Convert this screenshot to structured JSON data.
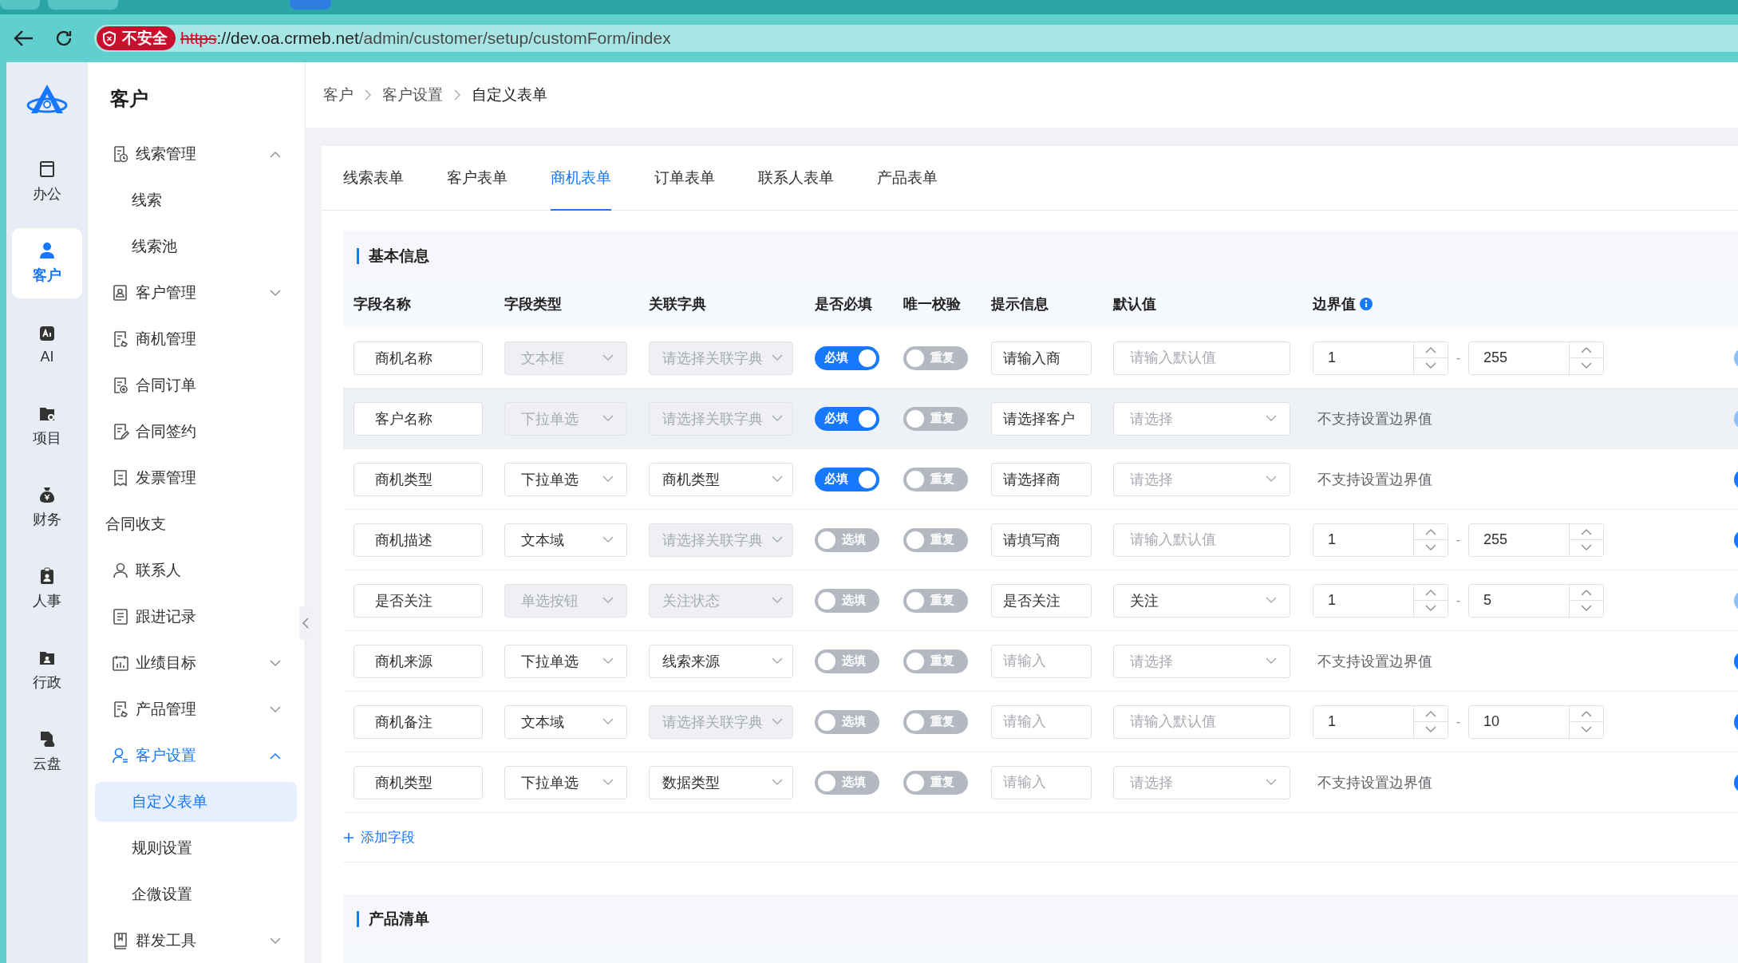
{
  "browser": {
    "tabs": [
      {
        "selected": false
      },
      {
        "selected": false
      },
      {
        "selected": true
      }
    ],
    "security_badge": "不安全",
    "url_scheme": "https",
    "url_host": "://dev.oa.crmeb.net",
    "url_path": "/admin/customer/setup/customForm/index"
  },
  "rail": {
    "items": [
      {
        "label": "办公",
        "selected": false
      },
      {
        "label": "客户",
        "selected": true
      },
      {
        "label": "AI",
        "selected": false
      },
      {
        "label": "项目",
        "selected": false
      },
      {
        "label": "财务",
        "selected": false
      },
      {
        "label": "人事",
        "selected": false
      },
      {
        "label": "行政",
        "selected": false
      },
      {
        "label": "云盘",
        "selected": false
      }
    ]
  },
  "menu": {
    "title": "客户",
    "items": [
      {
        "label": "线索管理",
        "selected": false,
        "expanded": true,
        "children": [
          {
            "label": "线索",
            "selected": false
          },
          {
            "label": "线索池",
            "selected": false
          }
        ]
      },
      {
        "label": "客户管理",
        "selected": false,
        "expanded": false
      },
      {
        "label": "商机管理",
        "selected": false
      },
      {
        "label": "合同订单",
        "selected": false
      },
      {
        "label": "合同签约",
        "selected": false
      },
      {
        "label": "发票管理",
        "selected": false
      },
      {
        "label": "合同收支",
        "selected": false
      },
      {
        "label": "联系人",
        "selected": false
      },
      {
        "label": "跟进记录",
        "selected": false
      },
      {
        "label": "业绩目标",
        "selected": false,
        "expanded": false
      },
      {
        "label": "产品管理",
        "selected": false,
        "expanded": false
      },
      {
        "label": "客户设置",
        "selected": true,
        "expanded": true,
        "children": [
          {
            "label": "自定义表单",
            "selected": true
          },
          {
            "label": "规则设置",
            "selected": false
          },
          {
            "label": "企微设置",
            "selected": false
          }
        ]
      },
      {
        "label": "群发工具",
        "selected": false,
        "expanded": false
      }
    ]
  },
  "breadcrumb": [
    "客户",
    "客户设置",
    "自定义表单"
  ],
  "tabs": [
    {
      "label": "线索表单",
      "selected": false
    },
    {
      "label": "客户表单",
      "selected": false
    },
    {
      "label": "商机表单",
      "selected": true
    },
    {
      "label": "订单表单",
      "selected": false
    },
    {
      "label": "联系人表单",
      "selected": false
    },
    {
      "label": "产品表单",
      "selected": false
    }
  ],
  "sections": [
    {
      "title": "基本信息",
      "columns": [
        "字段名称",
        "字段类型",
        "关联字典",
        "是否必填",
        "唯一校验",
        "提示信息",
        "默认值",
        "边界值"
      ],
      "rows": [
        {
          "highlighted": false,
          "name": "商机名称",
          "type": {
            "value": "文本框",
            "disabled": true
          },
          "dict": {
            "placeholder": "请选择关联字典",
            "disabled": true
          },
          "required": {
            "on": true,
            "label": "必填"
          },
          "unique": {
            "on": false,
            "label": "重复"
          },
          "hint": {
            "value": "请输入商"
          },
          "default": {
            "kind": "input",
            "placeholder": "请输入默认值"
          },
          "bounds": {
            "kind": "range",
            "min": "1",
            "separator": "-",
            "max": "255"
          },
          "column_9": {
            "dimmed": true
          }
        },
        {
          "highlighted": true,
          "name": "客户名称",
          "type": {
            "value": "下拉单选",
            "disabled": true
          },
          "dict": {
            "placeholder": "请选择关联字典",
            "disabled": true
          },
          "required": {
            "on": true,
            "label": "必填"
          },
          "unique": {
            "on": false,
            "label": "重复"
          },
          "hint": {
            "value": "请选择客户"
          },
          "default": {
            "kind": "select",
            "placeholder": "请选择"
          },
          "bounds": {
            "kind": "text",
            "text": "不支持设置边界值"
          },
          "column_9": {
            "dimmed": true
          }
        },
        {
          "highlighted": false,
          "name": "商机类型",
          "type": {
            "value": "下拉单选",
            "disabled": false
          },
          "dict": {
            "value": "商机类型",
            "disabled": false
          },
          "required": {
            "on": true,
            "label": "必填"
          },
          "unique": {
            "on": false,
            "label": "重复"
          },
          "hint": {
            "value": "请选择商"
          },
          "default": {
            "kind": "select",
            "placeholder": "请选择"
          },
          "bounds": {
            "kind": "text",
            "text": "不支持设置边界值"
          },
          "column_9": {
            "dimmed": false
          }
        },
        {
          "highlighted": false,
          "name": "商机描述",
          "type": {
            "value": "文本域",
            "disabled": false
          },
          "dict": {
            "placeholder": "请选择关联字典",
            "disabled": true
          },
          "required": {
            "on": false,
            "label": "选填"
          },
          "unique": {
            "on": false,
            "label": "重复"
          },
          "hint": {
            "value": "请填写商"
          },
          "default": {
            "kind": "input",
            "placeholder": "请输入默认值"
          },
          "bounds": {
            "kind": "range",
            "min": "1",
            "separator": "-",
            "max": "255"
          },
          "column_9": {
            "dimmed": false
          }
        },
        {
          "highlighted": false,
          "name": "是否关注",
          "type": {
            "value": "单选按钮",
            "disabled": true
          },
          "dict": {
            "value": "关注状态",
            "disabled": true
          },
          "required": {
            "on": false,
            "label": "选填"
          },
          "unique": {
            "on": false,
            "label": "重复"
          },
          "hint": {
            "value": "是否关注"
          },
          "default": {
            "kind": "select",
            "value": "关注"
          },
          "bounds": {
            "kind": "range",
            "min": "1",
            "separator": "-",
            "max": "5"
          },
          "column_9": {
            "dimmed": true
          }
        },
        {
          "highlighted": false,
          "name": "商机来源",
          "type": {
            "value": "下拉单选",
            "disabled": false
          },
          "dict": {
            "value": "线索来源",
            "disabled": false
          },
          "required": {
            "on": false,
            "label": "选填"
          },
          "unique": {
            "on": false,
            "label": "重复"
          },
          "hint": {
            "placeholder": "请输入"
          },
          "default": {
            "kind": "select",
            "placeholder": "请选择"
          },
          "bounds": {
            "kind": "text",
            "text": "不支持设置边界值"
          },
          "column_9": {
            "dimmed": false
          }
        },
        {
          "highlighted": false,
          "name": "商机备注",
          "type": {
            "value": "文本域",
            "disabled": false
          },
          "dict": {
            "placeholder": "请选择关联字典",
            "disabled": true
          },
          "required": {
            "on": false,
            "label": "选填"
          },
          "unique": {
            "on": false,
            "label": "重复"
          },
          "hint": {
            "placeholder": "请输入"
          },
          "default": {
            "kind": "input",
            "placeholder": "请输入默认值"
          },
          "bounds": {
            "kind": "range",
            "min": "1",
            "separator": "-",
            "max": "10"
          },
          "column_9": {
            "dimmed": false
          }
        },
        {
          "highlighted": false,
          "name": "商机类型",
          "type": {
            "value": "下拉单选",
            "disabled": false
          },
          "dict": {
            "value": "数据类型",
            "disabled": false
          },
          "required": {
            "on": false,
            "label": "选填"
          },
          "unique": {
            "on": false,
            "label": "重复"
          },
          "hint": {
            "placeholder": "请输入"
          },
          "default": {
            "kind": "select",
            "placeholder": "请选择"
          },
          "bounds": {
            "kind": "text",
            "text": "不支持设置边界值"
          },
          "column_9": {
            "dimmed": false
          }
        }
      ],
      "add_field": "添加字段"
    },
    {
      "title": "产品清单"
    }
  ]
}
